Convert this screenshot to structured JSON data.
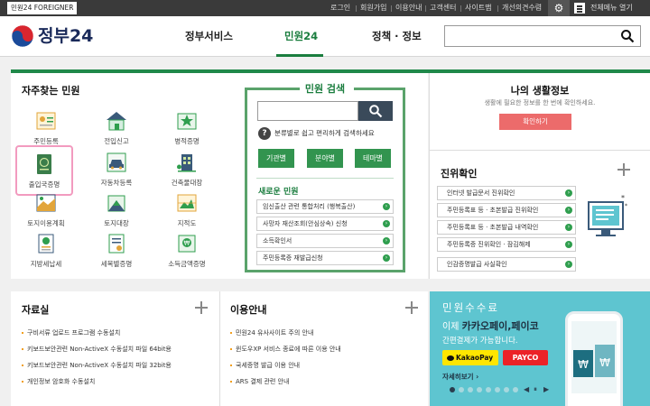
{
  "utility_bar": {
    "foreigner": "민원24 FOREIGNER",
    "links": [
      "로그인",
      "회원가입",
      "이용안내",
      "고객센터",
      "사이트맵",
      "개선의견수렴"
    ],
    "all_menu": "전체메뉴 열기"
  },
  "header": {
    "logo": "정부24",
    "nav": [
      "정부서비스",
      "민원24",
      "정책 · 정보"
    ],
    "active_nav": "민원24"
  },
  "frequent": {
    "title": "자주찾는 민원",
    "items": [
      {
        "label": "주민등록",
        "icon": "resident-card-icon"
      },
      {
        "label": "전입신고",
        "icon": "house-icon"
      },
      {
        "label": "병적증명",
        "icon": "military-badge-icon"
      },
      {
        "label": "출입국증명",
        "icon": "passport-icon",
        "highlighted": true
      },
      {
        "label": "자동차등록",
        "icon": "car-icon"
      },
      {
        "label": "건축물대장",
        "icon": "building-icon"
      },
      {
        "label": "토지이용계획",
        "icon": "land-plan-icon"
      },
      {
        "label": "토지대장",
        "icon": "land-map-icon"
      },
      {
        "label": "지적도",
        "icon": "cadastral-map-icon"
      },
      {
        "label": "지방세납세",
        "icon": "tax-certificate-icon"
      },
      {
        "label": "세목별증명",
        "icon": "tax-document-icon"
      },
      {
        "label": "소득금액증명",
        "icon": "income-certificate-icon"
      }
    ]
  },
  "civil_search": {
    "title": "민원 검색",
    "placeholder": "",
    "help": "분류별로 쉽고 편리하게 검색하세요",
    "tabs": [
      "기관별",
      "분야별",
      "테마별"
    ],
    "new_title": "새로운 민원",
    "new_items": [
      "임신출산 관련 통합처리 (행복출산)",
      "사망자 재산조회(안심상속) 신청",
      "소득확인서",
      "주민등록증 재발급신청"
    ]
  },
  "my_info": {
    "title": "나의 생활정보",
    "desc": "생활에 필요한 정보를 한 번에 확인하세요.",
    "button": "확인하기"
  },
  "verify": {
    "title": "진위확인",
    "items": [
      "인터넷 발급문서 진위확인",
      "주민등록표 등 · 초본발급 진위확인",
      "주민등록표 등 · 초본발급 내역확인",
      "주민등록증 진위확인 · 잠김해제",
      "인감증명발급 사실확인"
    ]
  },
  "resources": {
    "title": "자료실",
    "items": [
      "구비서류 업로드 프로그램 수동설치",
      "키보드보안관련 Non-ActiveX 수동설치 파일 64bit용",
      "키보드보안관련 Non-ActiveX 수동설치 파일 32bit용",
      "개인정보 암호화 수동설치"
    ]
  },
  "guide": {
    "title": "이용안내",
    "items": [
      "민원24 유사사이트 주의 안내",
      "윈도우XP 서비스 종료에 따른 이용 안내",
      "국세증명 발급 이용 안내",
      "ARS 결제 관련 안내"
    ]
  },
  "banner": {
    "line1": "민원수수료",
    "line2_prefix": "이제",
    "line2_highlight": "카카오페이,페이코",
    "line3": "간편결제가 가능합니다.",
    "kakao": "KakaoPay",
    "payco": "PAYCO",
    "more": "자세히보기",
    "controls": [
      "◀",
      "⏸",
      "▶"
    ]
  },
  "colors": {
    "brand_green": "#20894a",
    "highlight_pink": "#f29bbf",
    "confirm_red": "#ec6b6b",
    "banner_teal": "#5ec5d0"
  }
}
